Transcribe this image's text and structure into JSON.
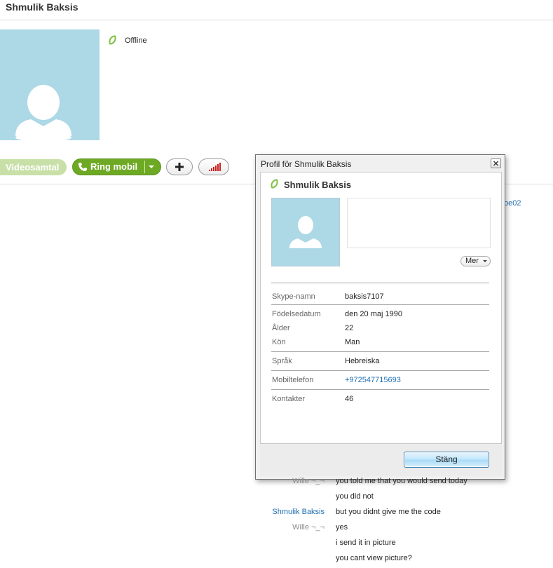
{
  "header": {
    "contact_name": "Shmulik Baksis"
  },
  "status": {
    "icon": "online-leaf-icon",
    "label": "Offline"
  },
  "actions": {
    "video_call_label": "Videosamtal",
    "ring_mobile_label": "Ring mobil",
    "add_icon": "plus-icon",
    "signal_icon": "call-quality-bars-icon"
  },
  "link_fragment": "fbe02",
  "profile_dialog": {
    "title": "Profil för Shmulik Baksis",
    "name": "Shmulik Baksis",
    "more_label": "Mer",
    "fields": [
      {
        "label": "Skype-namn",
        "value": "baksis7107"
      },
      {
        "label": "Födelsedatum",
        "value": "den 20 maj 1990"
      },
      {
        "label": "Ålder",
        "value": "22"
      },
      {
        "label": "Kön",
        "value": "Man"
      },
      {
        "label": "Språk",
        "value": "Hebreiska"
      },
      {
        "label": "Mobiltelefon",
        "value": "+972547715693"
      },
      {
        "label": "Kontakter",
        "value": "46"
      }
    ],
    "close_label": "Stäng"
  },
  "chat": [
    {
      "sender": "Wille ¬_¬",
      "text": "you told me that you would send today"
    },
    {
      "sender": "",
      "text": "you did not"
    },
    {
      "sender": "Shmulik Baksis",
      "text": "but you didnt give me the code"
    },
    {
      "sender": "Wille ¬_¬",
      "text": "yes"
    },
    {
      "sender": "",
      "text": "i send it in picture"
    },
    {
      "sender": "",
      "text": "you cant view picture?"
    }
  ],
  "colors": {
    "accent_green": "#6ea924",
    "avatar_bg": "#add8e6",
    "link_blue": "#1f6fb2",
    "own_sender_blue": "#1f6fb2",
    "other_sender_gray": "#8a8a8a"
  }
}
